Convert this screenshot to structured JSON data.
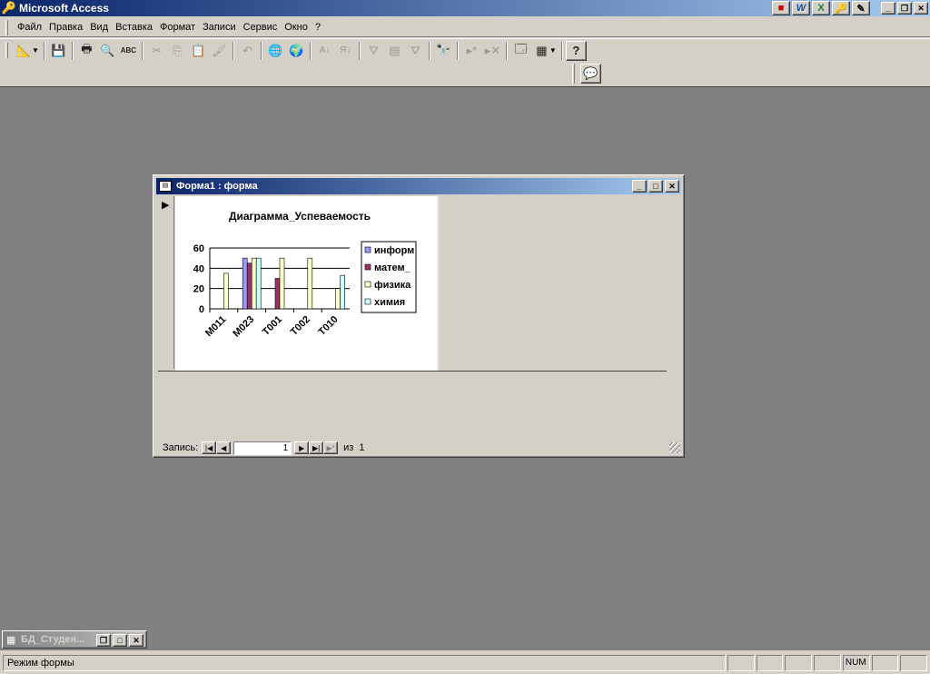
{
  "app": {
    "title": "Microsoft Access"
  },
  "menu": [
    "Файл",
    "Правка",
    "Вид",
    "Вставка",
    "Формат",
    "Записи",
    "Сервис",
    "Окно",
    "?"
  ],
  "form_window": {
    "title": "Форма1 : форма"
  },
  "navigation": {
    "label": "Запись:",
    "current": "1",
    "of_label": "из",
    "total": "1"
  },
  "db_window": {
    "title": "БД_Студен..."
  },
  "status": {
    "text": "Режим формы",
    "num": "NUM"
  },
  "chart_data": {
    "type": "bar",
    "title": "Диаграмма_Успеваемость",
    "categories": [
      "M011",
      "M023",
      "T001",
      "T002",
      "T010"
    ],
    "series": [
      {
        "name": "информ",
        "color": "#9999ff",
        "values": [
          0,
          50,
          0,
          0,
          0
        ]
      },
      {
        "name": "матем_",
        "color": "#993366",
        "values": [
          0,
          45,
          30,
          0,
          0
        ]
      },
      {
        "name": "физика",
        "color": "#ffffcc",
        "values": [
          35,
          50,
          50,
          50,
          20
        ]
      },
      {
        "name": "химия",
        "color": "#ccffff",
        "values": [
          0,
          50,
          0,
          0,
          33
        ]
      }
    ],
    "ylim": [
      0,
      60
    ],
    "yticks": [
      0,
      20,
      40,
      60
    ],
    "grid": true,
    "legend": "right"
  }
}
